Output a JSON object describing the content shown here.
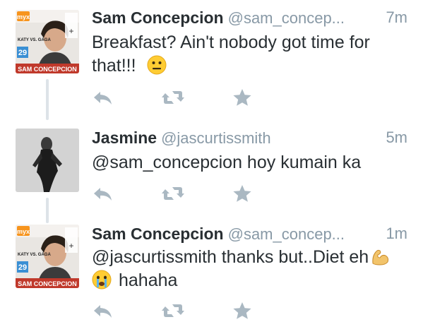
{
  "tweets": [
    {
      "name": "Sam Concepcion",
      "handle": "@sam_concep...",
      "time": "7m",
      "text_line1": "Breakfast? Ain't nobody got time for",
      "text_line2": "that!!!",
      "emoji": "neutral-face",
      "avatar": {
        "brand": "myx",
        "line1": "KATY VS. GAGA",
        "number": "29",
        "banner": "SAM CONCEPCION"
      }
    },
    {
      "name": "Jasmine",
      "handle": "@jascurtissmith",
      "time": "5m",
      "text_line1": "@sam_concepcion hoy kumain ka"
    },
    {
      "name": "Sam Concepcion",
      "handle": "@sam_concep...",
      "time": "1m",
      "text_line1": "@jascurtissmith thanks but..Diet eh",
      "text_line2": "hahaha",
      "emoji_inline": "flexed-biceps",
      "emoji_line2": "crying-face",
      "avatar": {
        "brand": "myx",
        "line1": "KATY VS. GAGA",
        "number": "29",
        "banner": "SAM CONCEPCION"
      }
    }
  ],
  "actions": [
    "reply-icon",
    "retweet-icon",
    "favorite-icon"
  ],
  "colors": {
    "name": "#292f33",
    "meta": "#8899a6",
    "action": "#aab8c2",
    "thread": "#dde3e8"
  }
}
